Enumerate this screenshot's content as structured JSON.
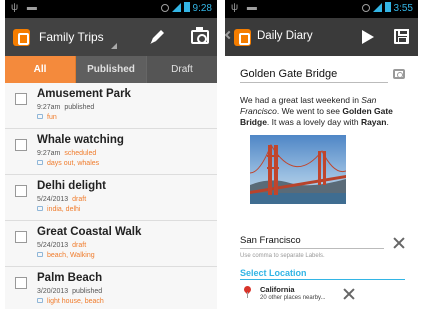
{
  "phone1": {
    "status": {
      "time": "9:28"
    },
    "action_bar": {
      "title": "Family Trips"
    },
    "tabs": [
      {
        "label": "All"
      },
      {
        "label": "Published"
      },
      {
        "label": "Draft"
      }
    ],
    "posts": [
      {
        "title": "Amusement Park",
        "date": "9:27am",
        "status": "published",
        "labels": "fun"
      },
      {
        "title": "Whale watching",
        "date": "9:27am",
        "status": "scheduled",
        "labels": "days out, whales"
      },
      {
        "title": "Delhi delight",
        "date": "5/24/2013",
        "status": "draft",
        "labels": "india, delhi"
      },
      {
        "title": "Great Coastal Walk",
        "date": "5/24/2013",
        "status": "draft",
        "labels": "beach, Walking"
      },
      {
        "title": "Palm Beach",
        "date": "3/20/2013",
        "status": "published",
        "labels": "light house, beach"
      }
    ]
  },
  "phone2": {
    "status": {
      "time": "3:55"
    },
    "action_bar": {
      "title": "Daily Diary"
    },
    "post_title": "Golden Gate Bridge",
    "body": {
      "t1": "We had a great last weekend in ",
      "em1": "San Francisco",
      "t2": ". We went to see ",
      "b1": "Golden Gate Bridge",
      "t3": ". It was a lovely day with ",
      "b2": "Rayan",
      "t4": "."
    },
    "location_value": "San Francisco",
    "labels_hint": "Use comma to separate Labels.",
    "select_location": "Select Location",
    "place": {
      "name": "California",
      "sub": "20 other places nearby..."
    }
  },
  "colors": {
    "accent_orange": "#f48a3c",
    "status_orange": "#f07c2c",
    "holo_blue": "#33b5e5",
    "action_bar": "#424242"
  }
}
